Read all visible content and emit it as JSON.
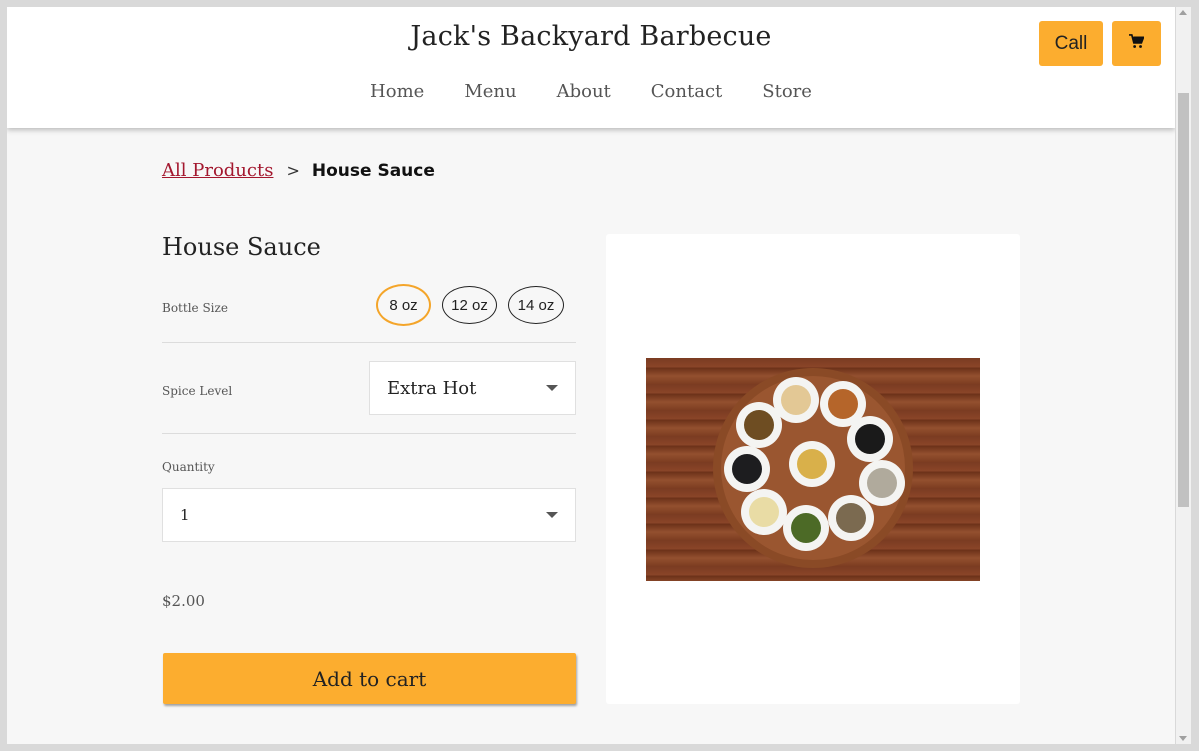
{
  "header": {
    "site_title": "Jack's Backyard Barbecue",
    "nav": [
      "Home",
      "Menu",
      "About",
      "Contact",
      "Store"
    ],
    "call_label": "Call",
    "cart_icon": "shopping-cart-icon",
    "accent_color": "#fcad2f"
  },
  "breadcrumb": {
    "link": "All Products",
    "separator": ">",
    "current": "House Sauce"
  },
  "product": {
    "title": "House Sauce",
    "bottle_size_label": "Bottle Size",
    "bottle_sizes": [
      "8 oz",
      "12 oz",
      "14 oz"
    ],
    "selected_size": "8 oz",
    "spice_label": "Spice Level",
    "spice_value": "Extra Hot",
    "quantity_label": "Quantity",
    "quantity_value": "1",
    "price": "$2.00",
    "add_to_cart": "Add to cart",
    "link_color": "#a3172e"
  }
}
